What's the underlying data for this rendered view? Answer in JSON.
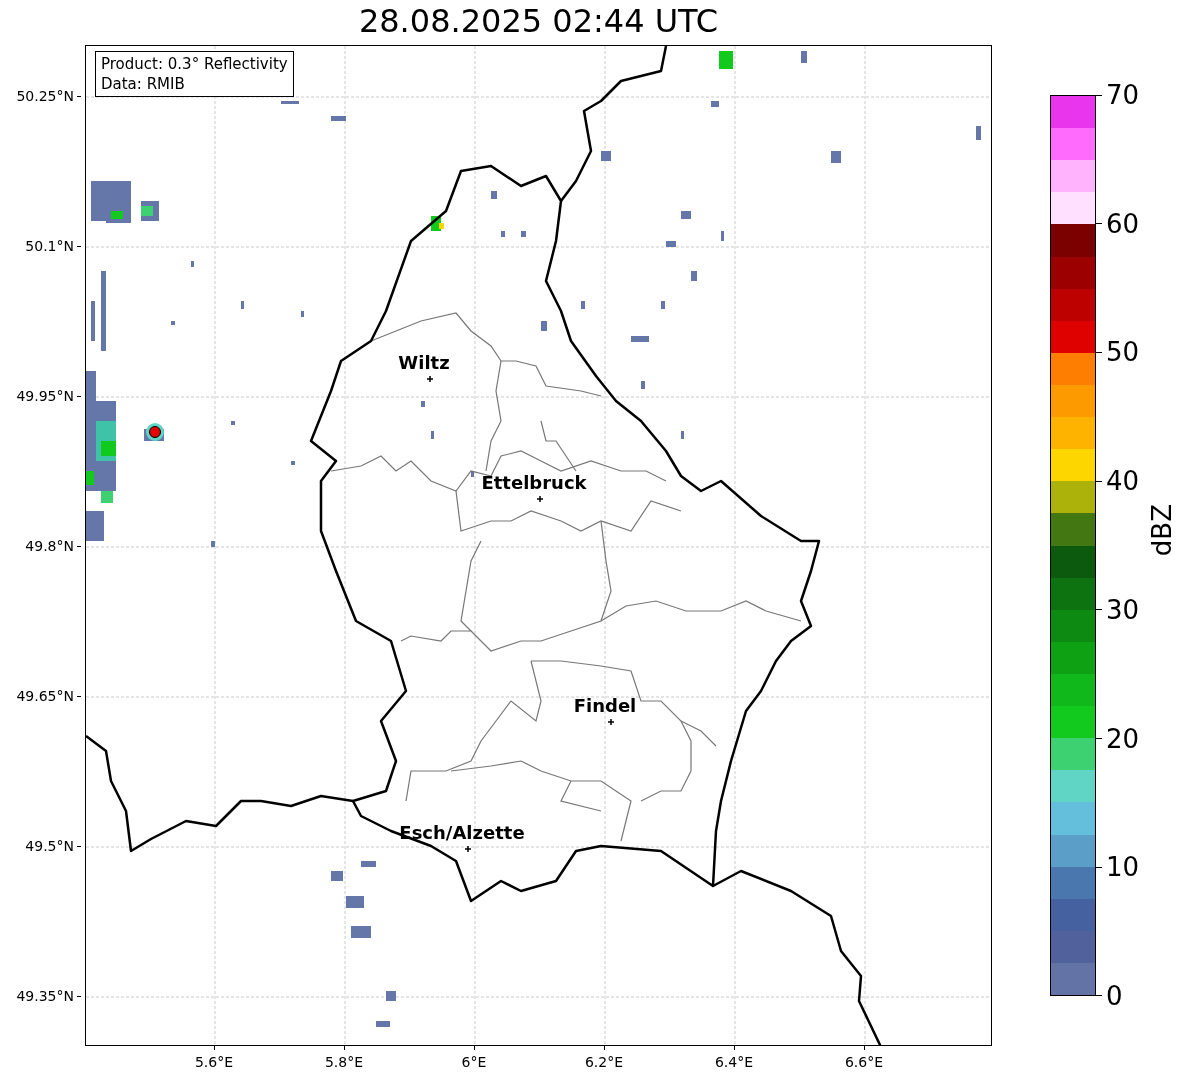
{
  "title": "28.08.2025 02:44 UTC",
  "info_box": {
    "lines": [
      "Product: 0.3° Reflectivity",
      "Data: RMIB"
    ]
  },
  "map": {
    "yticks": [
      "50.25°N",
      "50.1°N",
      "49.95°N",
      "49.8°N",
      "49.65°N",
      "49.5°N",
      "49.35°N"
    ],
    "xticks": [
      "5.6°E",
      "5.8°E",
      "6°E",
      "6.2°E",
      "6.4°E",
      "6.6°E"
    ],
    "cities": [
      {
        "name": "Wiltz"
      },
      {
        "name": "Ettelbruck"
      },
      {
        "name": "Findel"
      },
      {
        "name": "Esch/Alzette"
      }
    ]
  },
  "colorbar": {
    "label": "dBZ",
    "ticks": [
      "70",
      "60",
      "50",
      "40",
      "30",
      "20",
      "10",
      "0"
    ],
    "bins": [
      {
        "color": "#e935eb"
      },
      {
        "color": "#ff6cfd"
      },
      {
        "color": "#ffb3fd"
      },
      {
        "color": "#ffe0fe"
      },
      {
        "color": "#7b0000"
      },
      {
        "color": "#9c0000"
      },
      {
        "color": "#bd0000"
      },
      {
        "color": "#df0000"
      },
      {
        "color": "#fd7e00"
      },
      {
        "color": "#fd9a00"
      },
      {
        "color": "#fdb300"
      },
      {
        "color": "#fdd600"
      },
      {
        "color": "#adb20b"
      },
      {
        "color": "#437711"
      },
      {
        "color": "#0b5a0e"
      },
      {
        "color": "#0c7310"
      },
      {
        "color": "#0c8a12"
      },
      {
        "color": "#0fa114"
      },
      {
        "color": "#10b81b"
      },
      {
        "color": "#12c91e"
      },
      {
        "color": "#3ed172"
      },
      {
        "color": "#60d5c6"
      },
      {
        "color": "#63bfdc"
      },
      {
        "color": "#5b9ec7"
      },
      {
        "color": "#4a78ae"
      },
      {
        "color": "#4561a0"
      },
      {
        "color": "#51619c"
      },
      {
        "color": "#6473a6"
      }
    ]
  }
}
